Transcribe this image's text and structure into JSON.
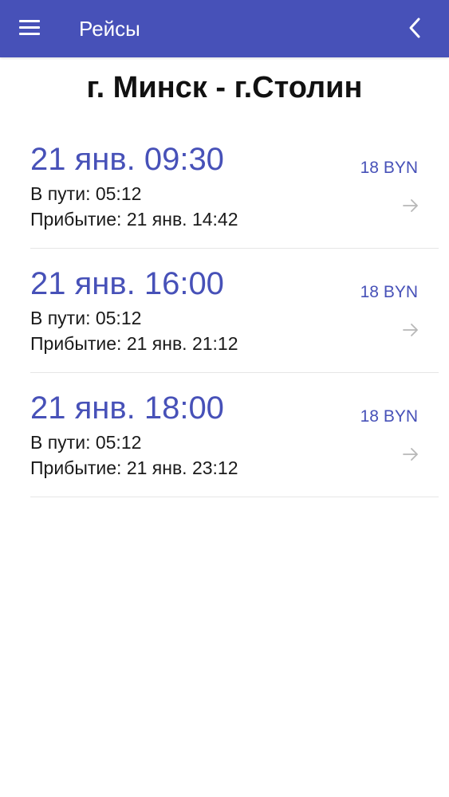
{
  "app_bar": {
    "title": "Рейсы",
    "menu_icon": "hamburger-menu-icon",
    "back_icon": "chevron-left-icon",
    "background_color": "#4751b8"
  },
  "route": {
    "title": "г. Минск - г.Столин"
  },
  "trips": [
    {
      "departure": "21 янв. 09:30",
      "duration": "В пути: 05:12",
      "arrival": "Прибытие: 21 янв. 14:42",
      "price": "18 BYN",
      "arrow_icon": "arrow-right-icon"
    },
    {
      "departure": "21 янв. 16:00",
      "duration": "В пути: 05:12",
      "arrival": "Прибытие: 21 янв. 21:12",
      "price": "18 BYN",
      "arrow_icon": "arrow-right-icon"
    },
    {
      "departure": "21 янв. 18:00",
      "duration": "В пути: 05:12",
      "arrival": "Прибытие: 21 янв. 23:12",
      "price": "18 BYN",
      "arrow_icon": "arrow-right-icon"
    }
  ],
  "colors": {
    "accent": "#4751b8",
    "text": "#1a1a1a",
    "divider": "#e6e6e6",
    "arrow": "#b8b8b8"
  }
}
